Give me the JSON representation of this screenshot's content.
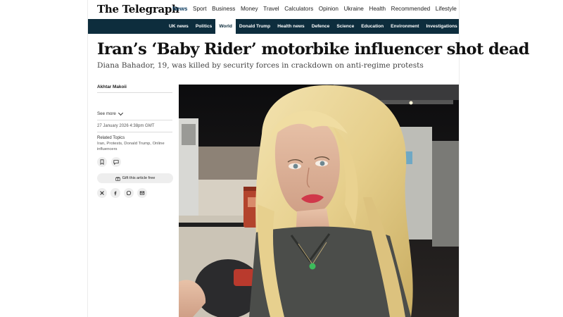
{
  "site": {
    "logo": "The Telegraph"
  },
  "main_nav": [
    "News",
    "Sport",
    "Business",
    "Money",
    "Travel",
    "Calculators",
    "Opinion",
    "Ukraine",
    "Health",
    "Recommended",
    "Lifestyle"
  ],
  "main_nav_active": "News",
  "sub_nav": [
    "UK news",
    "Politics",
    "World",
    "Donald Trump",
    "Health news",
    "Defence",
    "Science",
    "Education",
    "Environment",
    "Investigations"
  ],
  "sub_nav_active": "World",
  "article": {
    "headline": "Iran’s ‘Baby Rider’ motorbike influencer shot dead",
    "standfirst": "Diana Bahador, 19, was killed by security forces in crackdown on anti-regime protests",
    "author": "Akhtar Makoii",
    "see_more": "See more",
    "date": "27 January 2026 4:38pm GMT",
    "related_topics_title": "Related Topics",
    "related_topics": "Iran, Protests, Donald Trump, Online influencers",
    "gift_label": "Gift this article free"
  },
  "icons": {
    "bookmark": "bookmark-icon",
    "comment": "comment-icon",
    "gift": "gift-icon",
    "x": "x-icon",
    "facebook": "facebook-icon",
    "whatsapp": "whatsapp-icon",
    "email": "email-icon"
  },
  "colors": {
    "subnav_bg": "#0d2d3d",
    "active_nav": "#0a3a5f"
  }
}
